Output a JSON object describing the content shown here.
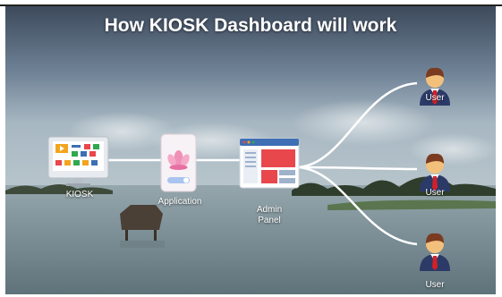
{
  "title": "How KIOSK Dashboard will work",
  "nodes": {
    "kiosk": "KIOSK",
    "application": "Application",
    "admin_line1": "Admin",
    "admin_line2": "Panel"
  },
  "users": [
    {
      "label": "User"
    },
    {
      "label": "User"
    },
    {
      "label": "User"
    }
  ],
  "colors": {
    "connector": "#ffffff",
    "suit": "#2b3a67",
    "tie": "#d32027",
    "skin": "#f3c07c",
    "hair": "#7a3b20",
    "admin_header": "#3e6fb4",
    "admin_block": "#e8474c",
    "app_flower": "#f090b8"
  }
}
